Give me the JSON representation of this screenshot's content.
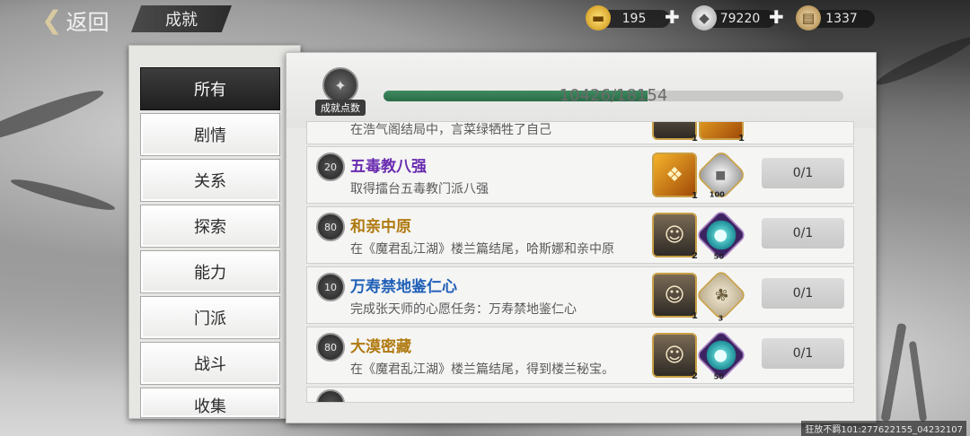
{
  "colors": {
    "accent_green": "#2e7a52",
    "title_purple": "#6a2bb0",
    "title_gold": "#b07a10",
    "title_blue": "#1f5fb7"
  },
  "header": {
    "back_label": "返回",
    "title": "成就"
  },
  "currencies": [
    {
      "icon": "gold-ingot-icon",
      "value": "195"
    },
    {
      "icon": "silver-ingot-icon",
      "value": "79220"
    },
    {
      "icon": "scroll-icon",
      "value": "1337"
    }
  ],
  "tabs": [
    "所有",
    "剧情",
    "关系",
    "探索",
    "能力",
    "门派",
    "战斗",
    "收集"
  ],
  "points": {
    "label": "成就点数",
    "current": 10426,
    "total": 18154,
    "text": "10426/18154"
  },
  "achievements": [
    {
      "points": "",
      "name": "",
      "desc": "在浩气阁结局中，言菜绿牺牲了自己",
      "rewards": [
        {
          "icon": "portrait-icon",
          "qty": "1"
        },
        {
          "icon": "item-icon",
          "qty": "1"
        }
      ],
      "progress": ""
    },
    {
      "points": "20",
      "name": "五毒教八强",
      "desc": "取得擂台五毒教门派八强",
      "rewards": [
        {
          "icon": "manual-icon",
          "qty": "1"
        },
        {
          "icon": "silver-ingot-icon",
          "qty": "100"
        }
      ],
      "progress": "0/1"
    },
    {
      "points": "80",
      "name": "和亲中原",
      "desc": "在《魔君乱江湖》楼兰篇结尾，哈斯娜和亲中原",
      "rewards": [
        {
          "icon": "portrait-icon",
          "qty": "2"
        },
        {
          "icon": "gem-icon",
          "qty": "50"
        }
      ],
      "progress": "0/1"
    },
    {
      "points": "10",
      "name": "万寿禁地鉴仁心",
      "desc": "完成张天师的心愿任务：万寿禁地鉴仁心",
      "rewards": [
        {
          "icon": "portrait-icon",
          "qty": "1"
        },
        {
          "icon": "paper-icon",
          "qty": "3"
        }
      ],
      "progress": "0/1"
    },
    {
      "points": "80",
      "name": "大漠密藏",
      "desc": "在《魔君乱江湖》楼兰篇结尾，得到楼兰秘宝。",
      "rewards": [
        {
          "icon": "portrait-icon",
          "qty": "2"
        },
        {
          "icon": "gem-icon",
          "qty": "50"
        }
      ],
      "progress": "0/1"
    }
  ],
  "watermark": "狂放不羁101:277622155_04232107"
}
